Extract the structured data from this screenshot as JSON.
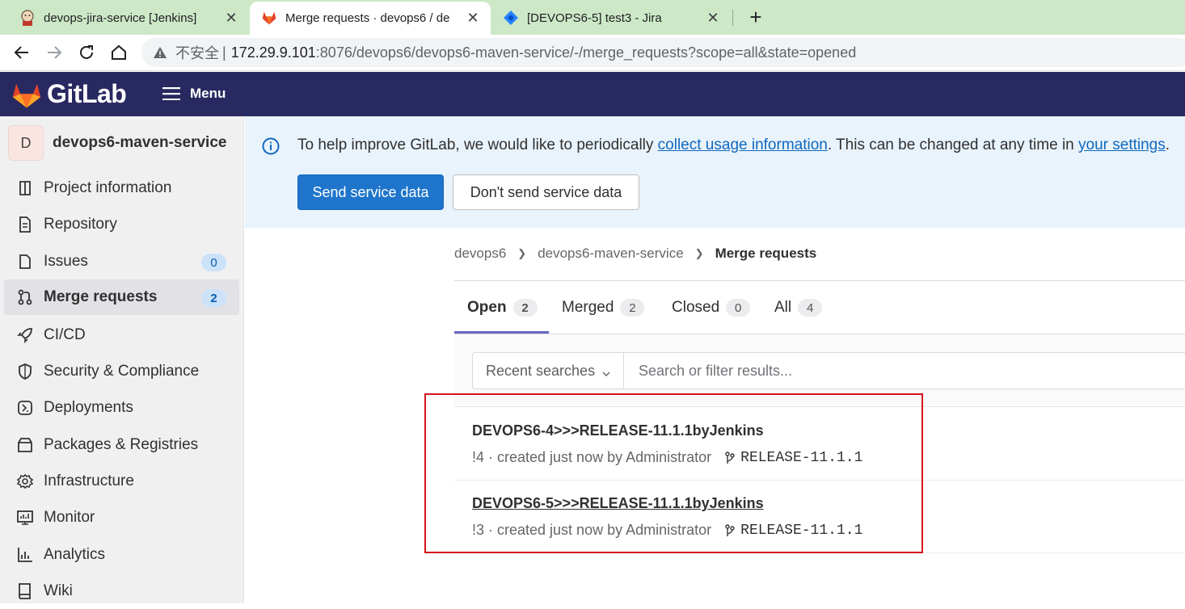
{
  "browser": {
    "tabs": [
      {
        "title": "devops-jira-service [Jenkins]",
        "icon": "jenkins-icon"
      },
      {
        "title": "Merge requests · devops6 / de",
        "icon": "gitlab-icon"
      },
      {
        "title": "[DEVOPS6-5] test3 - Jira",
        "icon": "jira-icon"
      }
    ],
    "new_tab_glyph": "+",
    "close_glyph": "✕",
    "address": {
      "insecure_label": "不安全",
      "separator": "|",
      "host": "172.29.9.101",
      "rest": ":8076/devops6/devops6-maven-service/-/merge_requests?scope=all&state=opened"
    }
  },
  "header": {
    "brand": "GitLab",
    "menu_label": "Menu",
    "header_bg": "#292961"
  },
  "sidebar": {
    "project_avatar": "D",
    "project_name": "devops6-maven-service",
    "items": [
      {
        "label": "Project information",
        "icon": "info-icon"
      },
      {
        "label": "Repository",
        "icon": "document-icon"
      },
      {
        "label": "Issues",
        "icon": "issues-icon",
        "badge": "0"
      },
      {
        "label": "Merge requests",
        "icon": "merge-request-icon",
        "badge": "2"
      },
      {
        "label": "CI/CD",
        "icon": "rocket-icon"
      },
      {
        "label": "Security & Compliance",
        "icon": "shield-icon"
      },
      {
        "label": "Deployments",
        "icon": "deployments-icon"
      },
      {
        "label": "Packages & Registries",
        "icon": "package-icon"
      },
      {
        "label": "Infrastructure",
        "icon": "cloud-gear-icon"
      },
      {
        "label": "Monitor",
        "icon": "monitor-icon"
      },
      {
        "label": "Analytics",
        "icon": "chart-icon"
      },
      {
        "label": "Wiki",
        "icon": "book-icon"
      }
    ]
  },
  "banner": {
    "text_before": "To help improve GitLab, we would like to periodically ",
    "link1": "collect usage information",
    "text_middle": ". This can be changed at any time in ",
    "link2": "your settings",
    "text_after": ".",
    "primary_button": "Send service data",
    "secondary_button": "Don't send service data"
  },
  "breadcrumb": {
    "items": [
      "devops6",
      "devops6-maven-service",
      "Merge requests"
    ]
  },
  "mr_tabs": [
    {
      "label": "Open",
      "count": "2"
    },
    {
      "label": "Merged",
      "count": "2"
    },
    {
      "label": "Closed",
      "count": "0"
    },
    {
      "label": "All",
      "count": "4"
    }
  ],
  "filter": {
    "recent_label": "Recent searches",
    "placeholder": "Search or filter results..."
  },
  "merge_requests": [
    {
      "title": "DEVOPS6-4>>>RELEASE-11.1.1byJenkins",
      "meta": "!4 · created just now by Administrator",
      "branch": "RELEASE-11.1.1"
    },
    {
      "title": "DEVOPS6-5>>>RELEASE-11.1.1byJenkins",
      "meta": "!3 · created just now by Administrator",
      "branch": "RELEASE-11.1.1"
    }
  ],
  "colors": {
    "accent": "#1f75cb",
    "highlight": "#d3131b",
    "active_tab": "#6666c4"
  }
}
